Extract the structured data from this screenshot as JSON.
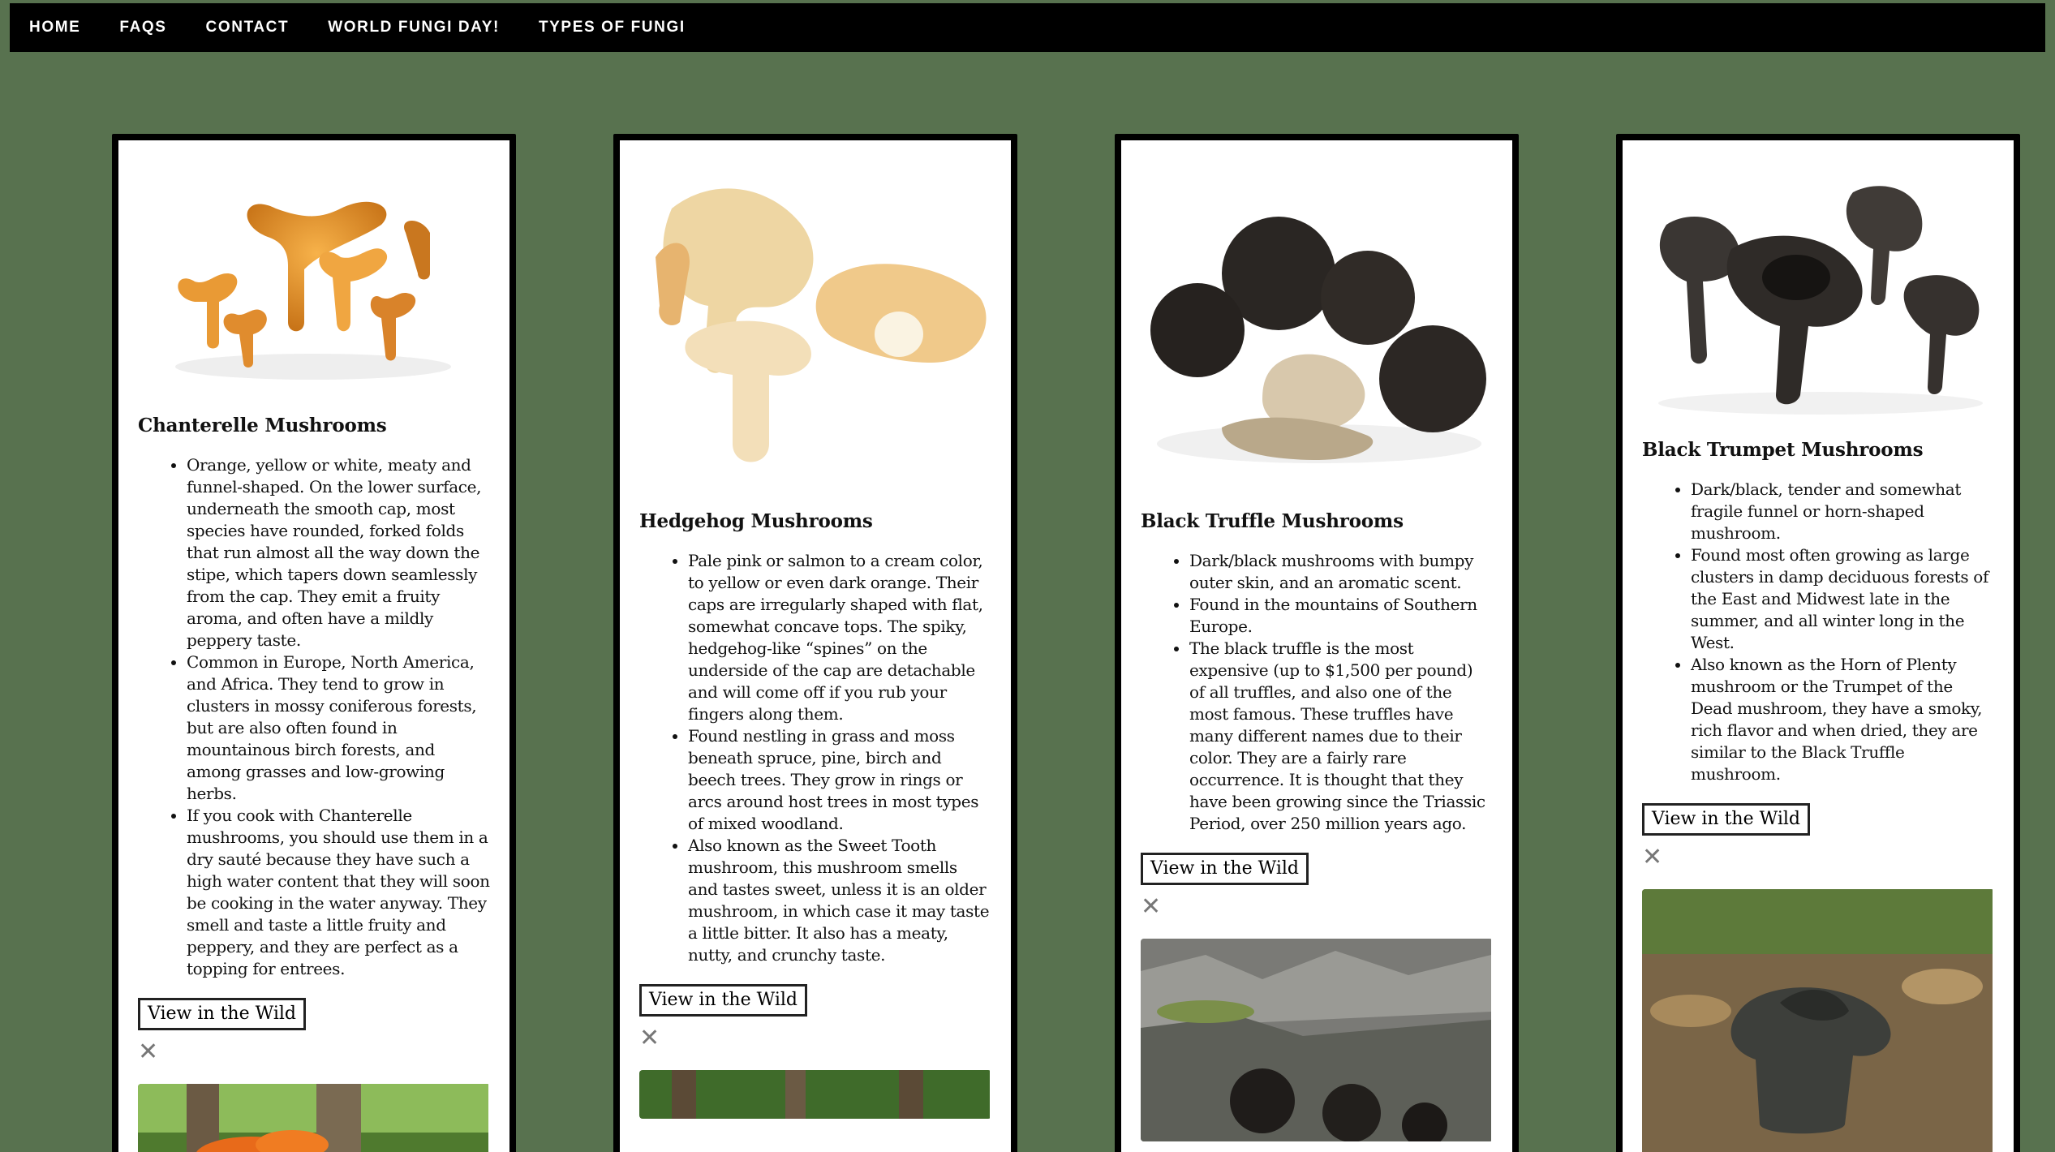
{
  "nav": {
    "items": [
      "HOME",
      "FAQS",
      "CONTACT",
      "WORLD FUNGI DAY!",
      "TYPES OF FUNGI"
    ]
  },
  "cards": [
    {
      "title": "Chanterelle Mushrooms",
      "facts": [
        "Orange, yellow or white, meaty and funnel-shaped. On the lower surface, underneath the smooth cap, most species have rounded, forked folds that run almost all the way down the stipe, which tapers down seamlessly from the cap. They emit a fruity aroma, and often have a mildly peppery taste.",
        "Common in Europe, North America, and Africa. They tend to grow in clusters in mossy coniferous forests, but are also often found in mountainous birch forests, and among grasses and low-growing herbs.",
        "If you cook with Chanterelle mushrooms, you should use them in a dry sauté because they have such a high water content that they will soon be cooking in the water anyway. They smell and taste a little fruity and peppery, and they are perfect as a topping for entrees."
      ],
      "button_label": "View in the Wild",
      "close_symbol": "✕"
    },
    {
      "title": "Hedgehog Mushrooms",
      "facts": [
        "Pale pink or salmon to a cream color, to yellow or even dark orange. Their caps are irregularly shaped with flat, somewhat concave tops. The spiky, hedgehog-like “spines” on the underside of the cap are detachable and will come off if you rub your fingers along them.",
        "Found nestling in grass and moss beneath spruce, pine, birch and beech trees. They grow in rings or arcs around host trees in most types of mixed woodland.",
        "Also known as the Sweet Tooth mushroom, this mushroom smells and tastes sweet, unless it is an older mushroom, in which case it may taste a little bitter. It also has a meaty, nutty, and crunchy taste."
      ],
      "button_label": "View in the Wild",
      "close_symbol": "✕"
    },
    {
      "title": "Black Truffle Mushrooms",
      "facts": [
        "Dark/black mushrooms with bumpy outer skin, and an aromatic scent.",
        "Found in the mountains of Southern Europe.",
        "The black truffle is the most expensive (up to $1,500 per pound) of all truffles, and also one of the most famous. These truffles have many different names due to their color. They are a fairly rare occurrence. It is thought that they have been growing since the Triassic Period, over 250 million years ago."
      ],
      "button_label": "View in the Wild",
      "close_symbol": "✕"
    },
    {
      "title": "Black Trumpet Mushrooms",
      "facts": [
        "Dark/black, tender and somewhat fragile funnel or horn-shaped mushroom.",
        "Found most often growing as large clusters in damp deciduous forests of the East and Midwest late in the summer, and all winter long in the West.",
        "Also known as the Horn of Plenty mushroom or the Trumpet of the Dead mushroom, they have a smoky, rich flavor and when dried, they are similar to the Black Truffle mushroom."
      ],
      "button_label": "View in the Wild",
      "close_symbol": "✕"
    }
  ]
}
